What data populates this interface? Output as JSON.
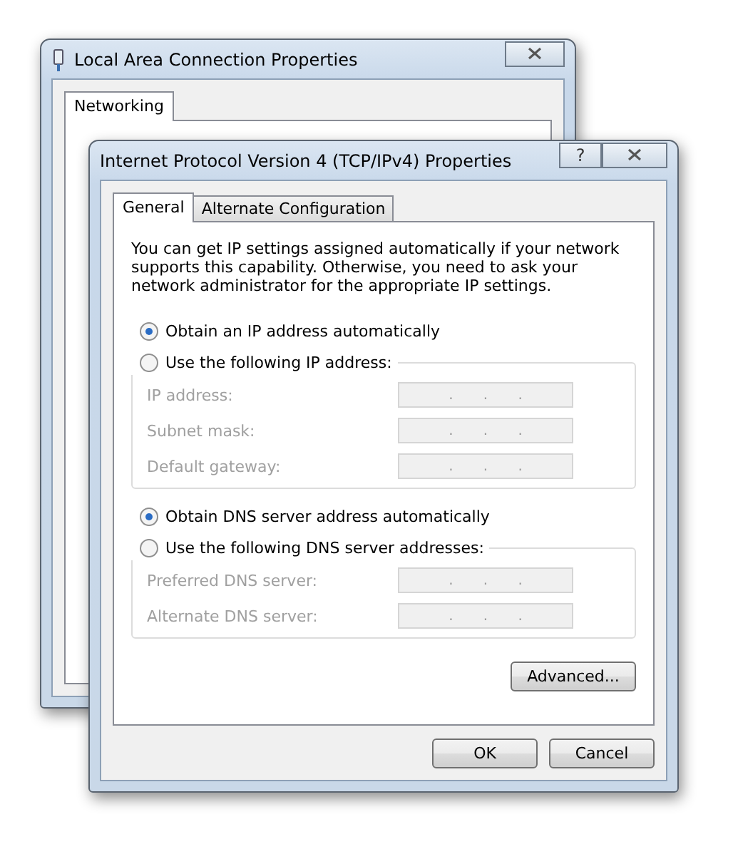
{
  "back_window": {
    "title": "Local Area Connection Properties",
    "tabs": [
      {
        "label": "Networking",
        "selected": true
      }
    ]
  },
  "dialog": {
    "title": "Internet Protocol Version 4 (TCP/IPv4) Properties",
    "help_button": "?",
    "tabs": [
      {
        "label": "General",
        "selected": true
      },
      {
        "label": "Alternate Configuration",
        "selected": false
      }
    ],
    "intro": "You can get IP settings assigned automatically if your network supports this capability. Otherwise, you need to ask your network administrator for the appropriate IP settings.",
    "sections": [
      {
        "auto_option": {
          "label": "Obtain an IP address automatically",
          "selected": true
        },
        "manual_option": {
          "label": "Use the following IP address:",
          "selected": false
        },
        "fields": [
          {
            "label": "IP address:",
            "disabled": true,
            "dots": [
              ".",
              ".",
              "."
            ]
          },
          {
            "label": "Subnet mask:",
            "disabled": true,
            "dots": [
              ".",
              ".",
              "."
            ]
          },
          {
            "label": "Default gateway:",
            "disabled": true,
            "dots": [
              ".",
              ".",
              "."
            ]
          }
        ]
      },
      {
        "auto_option": {
          "label": "Obtain DNS server address automatically",
          "selected": true
        },
        "manual_option": {
          "label": "Use the following DNS server addresses:",
          "selected": false
        },
        "fields": [
          {
            "label": "Preferred DNS server:",
            "disabled": true,
            "dots": [
              ".",
              ".",
              "."
            ]
          },
          {
            "label": "Alternate DNS server:",
            "disabled": true,
            "dots": [
              ".",
              ".",
              "."
            ]
          }
        ]
      }
    ],
    "advanced_button": "Advanced...",
    "buttons": [
      "OK",
      "Cancel"
    ]
  }
}
